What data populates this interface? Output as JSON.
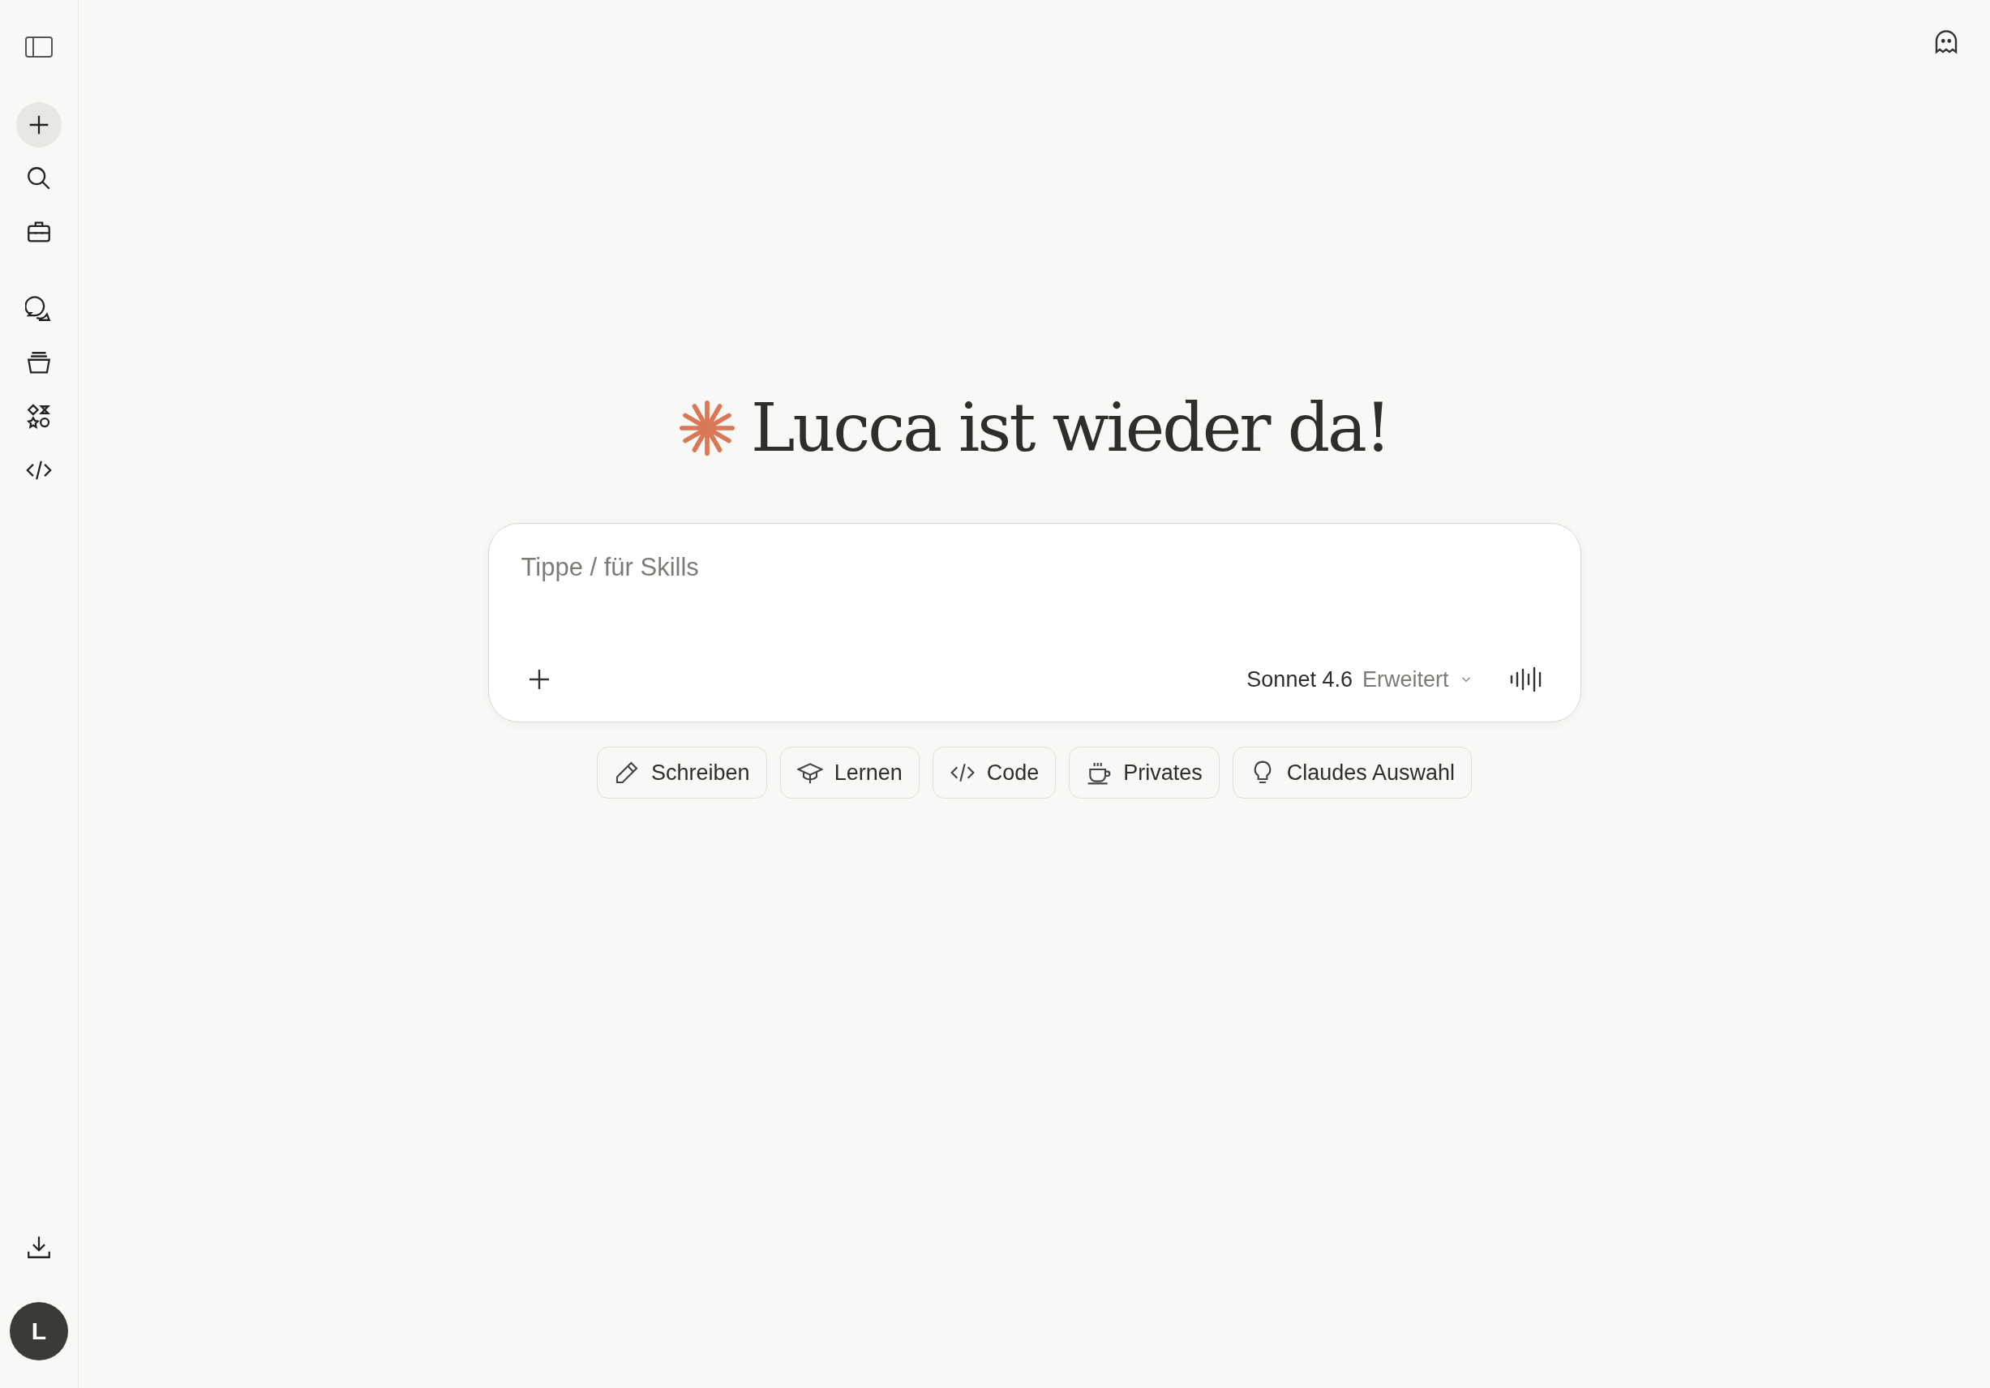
{
  "sidebar": {
    "top_items": [
      {
        "kind": "new"
      },
      {
        "kind": "search"
      },
      {
        "kind": "toolbox"
      }
    ],
    "nav_items": [
      {
        "kind": "chats"
      },
      {
        "kind": "projects"
      },
      {
        "kind": "artifacts"
      },
      {
        "kind": "code"
      }
    ],
    "avatar": {
      "initial": "L"
    }
  },
  "heading": "Lucca ist wieder da!",
  "composer": {
    "placeholder": "Tippe / für Skills",
    "model": "Sonnet 4.6",
    "mode": "Erweitert"
  },
  "suggestions": [
    {
      "kind": "write",
      "label": "Schreiben"
    },
    {
      "kind": "learn",
      "label": "Lernen"
    },
    {
      "kind": "code",
      "label": "Code"
    },
    {
      "kind": "personal",
      "label": "Privates"
    },
    {
      "kind": "idea",
      "label": "Claudes Auswahl"
    }
  ]
}
